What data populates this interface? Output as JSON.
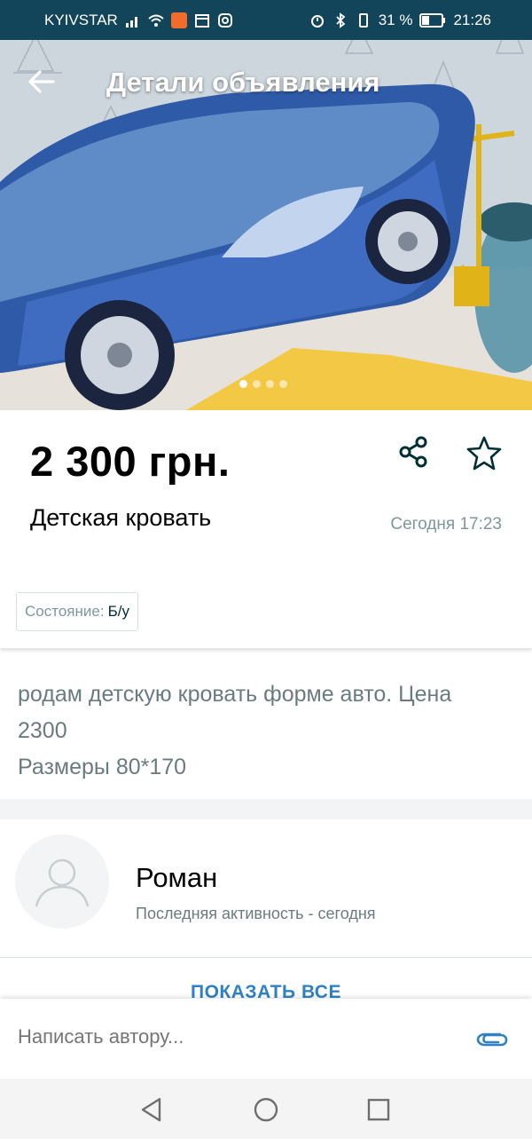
{
  "status_bar": {
    "carrier": "KYIVSTAR",
    "battery": "31 %",
    "time": "21:26"
  },
  "header": {
    "title": "Детали объявления",
    "back_icon": "arrow-left-icon"
  },
  "gallery": {
    "photo_count": 4,
    "active_index": 0
  },
  "ad": {
    "price": "2 300 грн.",
    "title": "Детская кровать",
    "date": "Сегодня 17:23",
    "params": [
      {
        "key": "Состояние:",
        "value": "Б/у"
      }
    ]
  },
  "description": {
    "lines": [
      "родам детскую кровать форме авто. Цена",
      "2300",
      "Размеры 80*170"
    ]
  },
  "seller": {
    "name": "Роман",
    "activity": "Последняя активность - сегодня",
    "show_all": "ПОКАЗАТЬ ВСЕ"
  },
  "message": {
    "placeholder": "Написать автору..."
  },
  "colors": {
    "status_bar": "#12455a",
    "accent": "#002f34",
    "link": "#2f80c4",
    "muted": "#7f9799"
  }
}
